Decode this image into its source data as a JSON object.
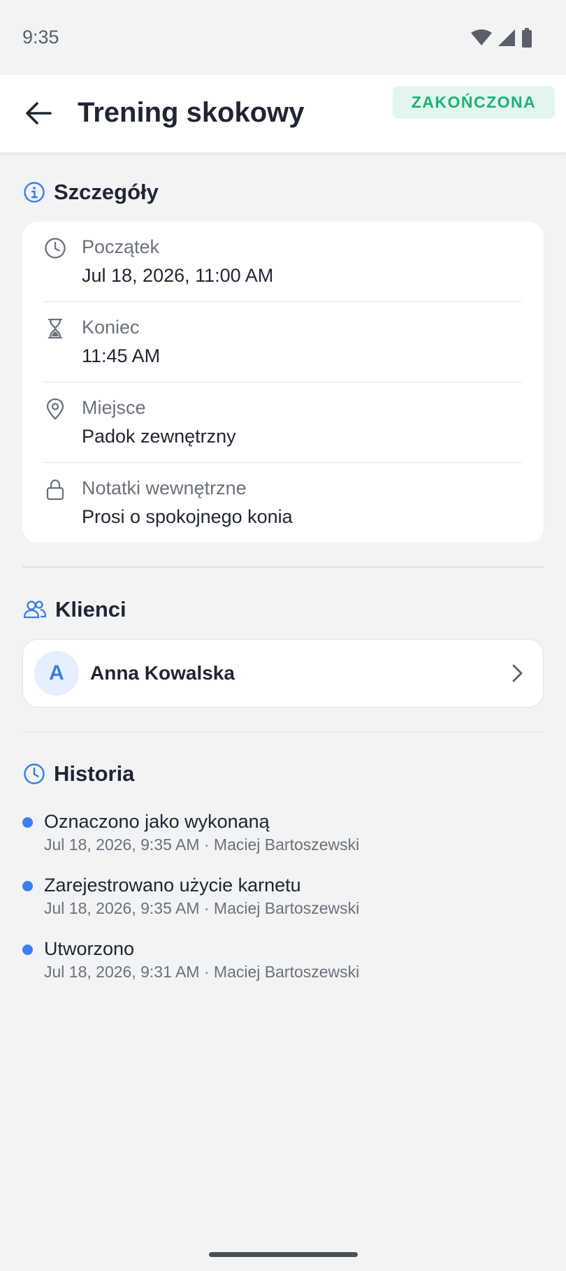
{
  "status_bar": {
    "time": "9:35"
  },
  "header": {
    "title": "Trening skokowy",
    "status": "ZAKOŃCZONA"
  },
  "details": {
    "section_title": "Szczegóły",
    "rows": [
      {
        "icon": "clock-icon",
        "label": "Początek",
        "value": "Jul 18, 2026, 11:00 AM"
      },
      {
        "icon": "hourglass-icon",
        "label": "Koniec",
        "value": "11:45 AM"
      },
      {
        "icon": "location-pin-icon",
        "label": "Miejsce",
        "value": "Padok zewnętrzny"
      },
      {
        "icon": "lock-icon",
        "label": "Notatki wewnętrzne",
        "value": "Prosi o spokojnego konia"
      }
    ]
  },
  "clients": {
    "section_title": "Klienci",
    "items": [
      {
        "initial": "A",
        "name": "Anna Kowalska"
      }
    ]
  },
  "history": {
    "section_title": "Historia",
    "items": [
      {
        "title": "Oznaczono jako wykonaną",
        "meta": "Jul 18, 2026, 9:35 AM · Maciej Bartoszewski"
      },
      {
        "title": "Zarejestrowano użycie karnetu",
        "meta": "Jul 18, 2026, 9:35 AM · Maciej Bartoszewski"
      },
      {
        "title": "Utworzono",
        "meta": "Jul 18, 2026, 9:31 AM · Maciej Bartoszewski"
      }
    ]
  },
  "colors": {
    "accent": "#3b7ddd",
    "status_badge_bg": "#e2f6ee",
    "status_badge_text": "#1fb07b",
    "history_dot": "#3b7ff0"
  }
}
